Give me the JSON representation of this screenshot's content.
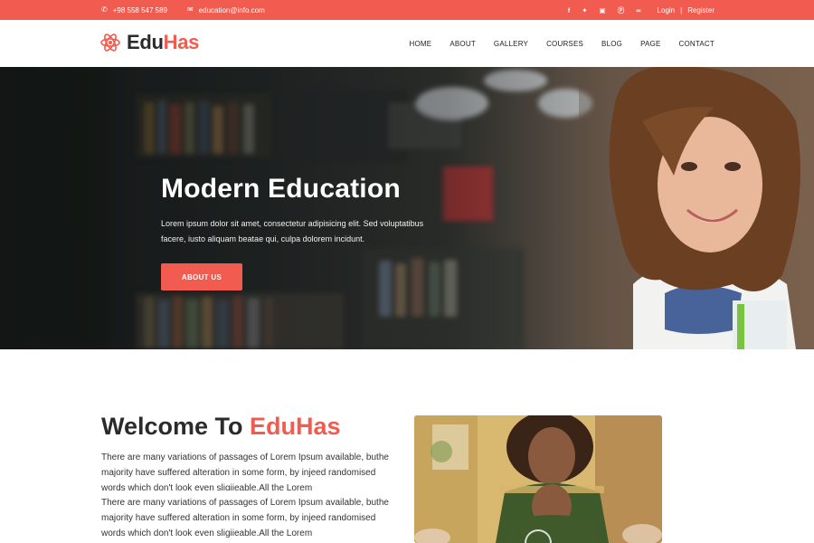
{
  "topbar": {
    "phone": "+98 558 547 589",
    "email": "education@info.com",
    "social": [
      "facebook-icon",
      "twitter-icon",
      "instagram-icon",
      "pinterest-icon",
      "rss-icon"
    ],
    "login": "Login",
    "separator": "|",
    "register": "Register"
  },
  "header": {
    "logo_text_main": "Edu",
    "logo_text_accent": "Has",
    "nav": [
      "HOME",
      "ABOUT",
      "GALLERY",
      "COURSES",
      "BLOG",
      "PAGE",
      "CONTACT"
    ]
  },
  "hero": {
    "title": "Modern Education",
    "text": "Lorem ipsum dolor sit amet, consectetur adipisicing elit. Sed voluptatibus facere, iusto aliquam beatae qui, culpa dolorem incidunt.",
    "button": "ABOUT US"
  },
  "welcome": {
    "title_main": "Welcome To",
    "title_accent": "EduHas",
    "paragraph1": "There are many variations of passages of Lorem Ipsum available, buthe majority have suffered alteration in some form, by injeed randomised words which don't look even sligiieable.All the Lorem",
    "paragraph2": "There are many variations of passages of Lorem Ipsum available, buthe majority have suffered alteration in some form, by injeed randomised words which don't look even sligiieable.All the Lorem"
  },
  "colors": {
    "accent": "#f25b4f",
    "dark_text": "#2b2b2b"
  }
}
